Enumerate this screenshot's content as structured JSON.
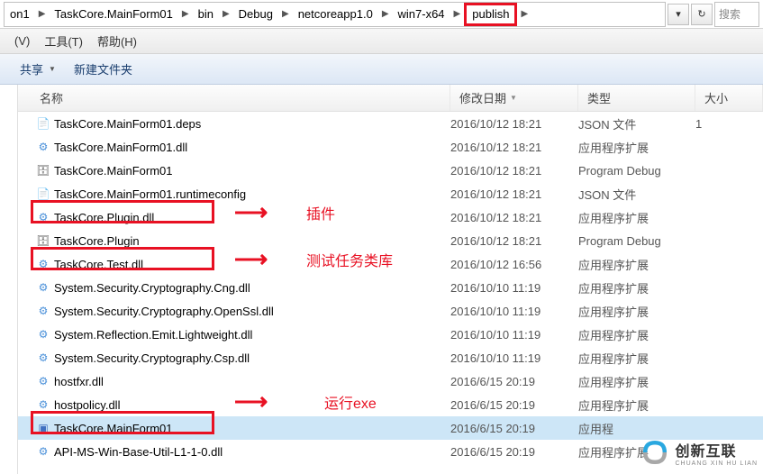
{
  "breadcrumb": {
    "items": [
      "on1",
      "TaskCore.MainForm01",
      "bin",
      "Debug",
      "netcoreapp1.0",
      "win7-x64",
      "publish"
    ]
  },
  "search": {
    "placeholder": "搜索"
  },
  "menu": {
    "view": "(V)",
    "tools": "工具(T)",
    "help": "帮助(H)"
  },
  "toolbar": {
    "share": "共享",
    "newfolder": "新建文件夹"
  },
  "columns": {
    "name": "名称",
    "date": "修改日期",
    "type": "类型",
    "size": "大小"
  },
  "files": [
    {
      "name": "TaskCore.MainForm01.deps",
      "date": "2016/10/12 18:21",
      "type": "JSON 文件",
      "size": "1",
      "icon": "json"
    },
    {
      "name": "TaskCore.MainForm01.dll",
      "date": "2016/10/12 18:21",
      "type": "应用程序扩展",
      "size": "",
      "icon": "dll"
    },
    {
      "name": "TaskCore.MainForm01",
      "date": "2016/10/12 18:21",
      "type": "Program Debug",
      "size": "",
      "icon": "pdb"
    },
    {
      "name": "TaskCore.MainForm01.runtimeconfig",
      "date": "2016/10/12 18:21",
      "type": "JSON 文件",
      "size": "",
      "icon": "json"
    },
    {
      "name": "TaskCore.Plugin.dll",
      "date": "2016/10/12 18:21",
      "type": "应用程序扩展",
      "size": "",
      "icon": "dll"
    },
    {
      "name": "TaskCore.Plugin",
      "date": "2016/10/12 18:21",
      "type": "Program Debug",
      "size": "",
      "icon": "pdb"
    },
    {
      "name": "TaskCore.Test.dll",
      "date": "2016/10/12 16:56",
      "type": "应用程序扩展",
      "size": "",
      "icon": "dll"
    },
    {
      "name": "System.Security.Cryptography.Cng.dll",
      "date": "2016/10/10 11:19",
      "type": "应用程序扩展",
      "size": "",
      "icon": "dll"
    },
    {
      "name": "System.Security.Cryptography.OpenSsl.dll",
      "date": "2016/10/10 11:19",
      "type": "应用程序扩展",
      "size": "",
      "icon": "dll"
    },
    {
      "name": "System.Reflection.Emit.Lightweight.dll",
      "date": "2016/10/10 11:19",
      "type": "应用程序扩展",
      "size": "",
      "icon": "dll"
    },
    {
      "name": "System.Security.Cryptography.Csp.dll",
      "date": "2016/10/10 11:19",
      "type": "应用程序扩展",
      "size": "",
      "icon": "dll"
    },
    {
      "name": "hostfxr.dll",
      "date": "2016/6/15 20:19",
      "type": "应用程序扩展",
      "size": "",
      "icon": "dll"
    },
    {
      "name": "hostpolicy.dll",
      "date": "2016/6/15 20:19",
      "type": "应用程序扩展",
      "size": "",
      "icon": "dll"
    },
    {
      "name": "TaskCore.MainForm01",
      "date": "2016/6/15 20:19",
      "type": "应用程",
      "size": "",
      "icon": "exe",
      "selected": true
    },
    {
      "name": "API-MS-Win-Base-Util-L1-1-0.dll",
      "date": "2016/6/15 20:19",
      "type": "应用程序扩展",
      "size": "",
      "icon": "dll"
    }
  ],
  "annotations": {
    "plugin": "插件",
    "testlib": "测试任务类库",
    "runexe": "运行exe"
  },
  "logo": {
    "text": "创新互联",
    "sub": "CHUANG XIN HU LIAN"
  }
}
